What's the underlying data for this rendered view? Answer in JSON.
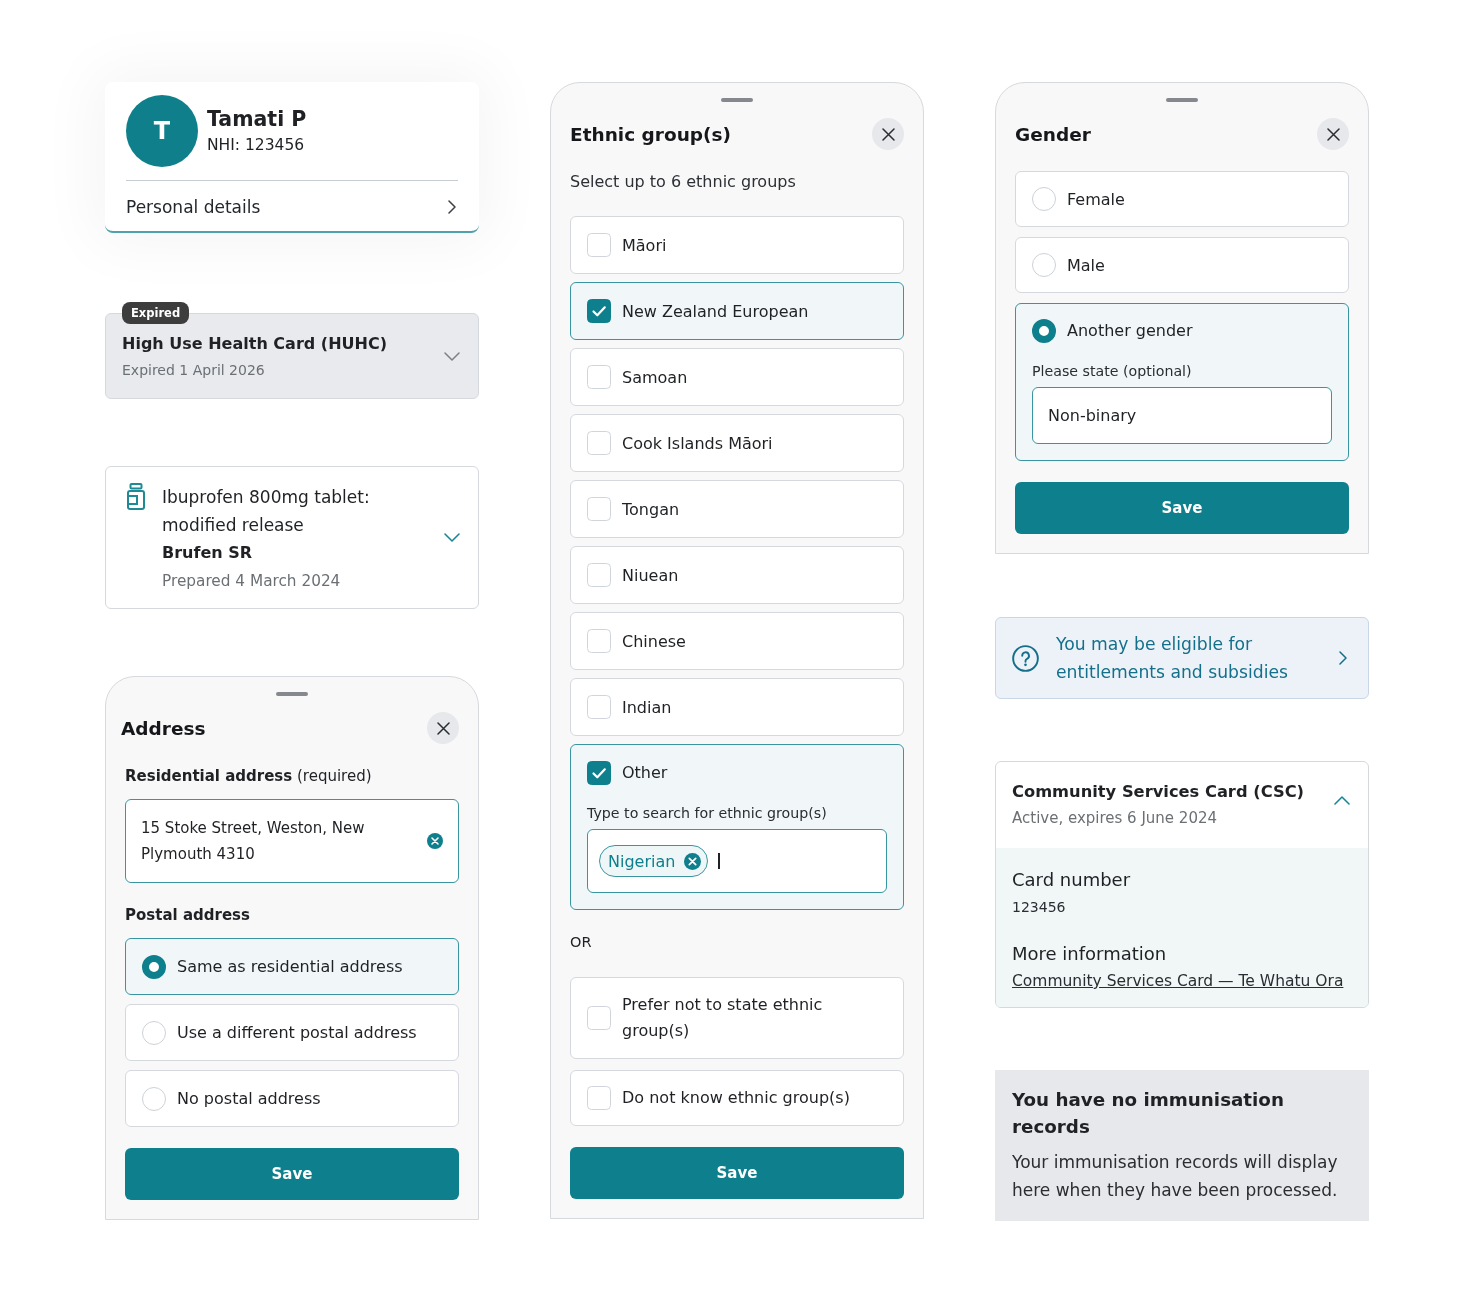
{
  "profile": {
    "initial": "T",
    "name": "Tamati P",
    "nhi": "NHI: 123456",
    "link": "Personal details"
  },
  "huhc_card": {
    "badge": "Expired",
    "title": "High Use Health Card (HUHC)",
    "subtitle": "Expired 1 April 2026",
    "expanded": false
  },
  "medication": {
    "name": "Ibuprofen 800mg tablet: modified release",
    "brand": "Brufen SR",
    "prepared": "Prepared 4 March 2024",
    "expanded": false
  },
  "address_sheet": {
    "title": "Address",
    "residential_label": "**Residential address** (required)",
    "residential_value": "15 Stoke Street, Weston, New Plymouth 4310",
    "postal_label": "Postal address",
    "postal_options": [
      {
        "label": "Same as residential address",
        "selected": true
      },
      {
        "label": "Use a different postal address",
        "selected": false
      },
      {
        "label": "No postal address",
        "selected": false
      }
    ],
    "save": "Save"
  },
  "ethnic_sheet": {
    "title": "Ethnic group(s)",
    "hint": "Select up to 6 ethnic groups",
    "options": [
      {
        "kind": "plain",
        "label": "Māori",
        "checked": false
      },
      {
        "kind": "plain",
        "label": "New Zealand European",
        "checked": true
      },
      {
        "kind": "plain",
        "label": "Samoan",
        "checked": false
      },
      {
        "kind": "plain",
        "label": "Cook Islands Māori",
        "checked": false
      },
      {
        "kind": "plain",
        "label": "Tongan",
        "checked": false
      },
      {
        "kind": "plain",
        "label": "Niuean",
        "checked": false
      },
      {
        "kind": "plain",
        "label": "Chinese",
        "checked": false
      },
      {
        "kind": "plain",
        "label": "Indian",
        "checked": false
      },
      {
        "kind": "search",
        "label": "Other",
        "checked": true,
        "field_label": "Type to search for ethnic group(s)",
        "tags": [
          "Nigerian"
        ]
      }
    ],
    "separator": "OR",
    "other_options": [
      {
        "label": "Prefer not to state ethnic group(s)",
        "checked": false
      },
      {
        "label": "Do not know ethnic group(s)",
        "checked": false
      }
    ],
    "save": "Save"
  },
  "gender_sheet": {
    "title": "Gender",
    "options": [
      {
        "kind": "plain",
        "label": "Female",
        "selected": false
      },
      {
        "kind": "plain",
        "label": "Male",
        "selected": false
      },
      {
        "kind": "text_entry",
        "label": "Another gender",
        "selected": true,
        "field_label": "Please state (optional)",
        "value": "Non-binary"
      }
    ],
    "save": "Save"
  },
  "eligibility_banner": {
    "text": "You may be eligible for entitlements and subsidies"
  },
  "csc_card": {
    "title": "Community Services Card (CSC)",
    "subtitle": "Active, expires 6 June 2024",
    "expanded": true,
    "details": [
      {
        "label": "Card number",
        "value": "123456"
      },
      {
        "label": "More information",
        "link": "Community Services Card — Te Whatu Ora"
      }
    ]
  },
  "immunisation_notice": {
    "title": "You have no immunisation records",
    "body": "Your immunisation records will display here when they have been processed."
  }
}
